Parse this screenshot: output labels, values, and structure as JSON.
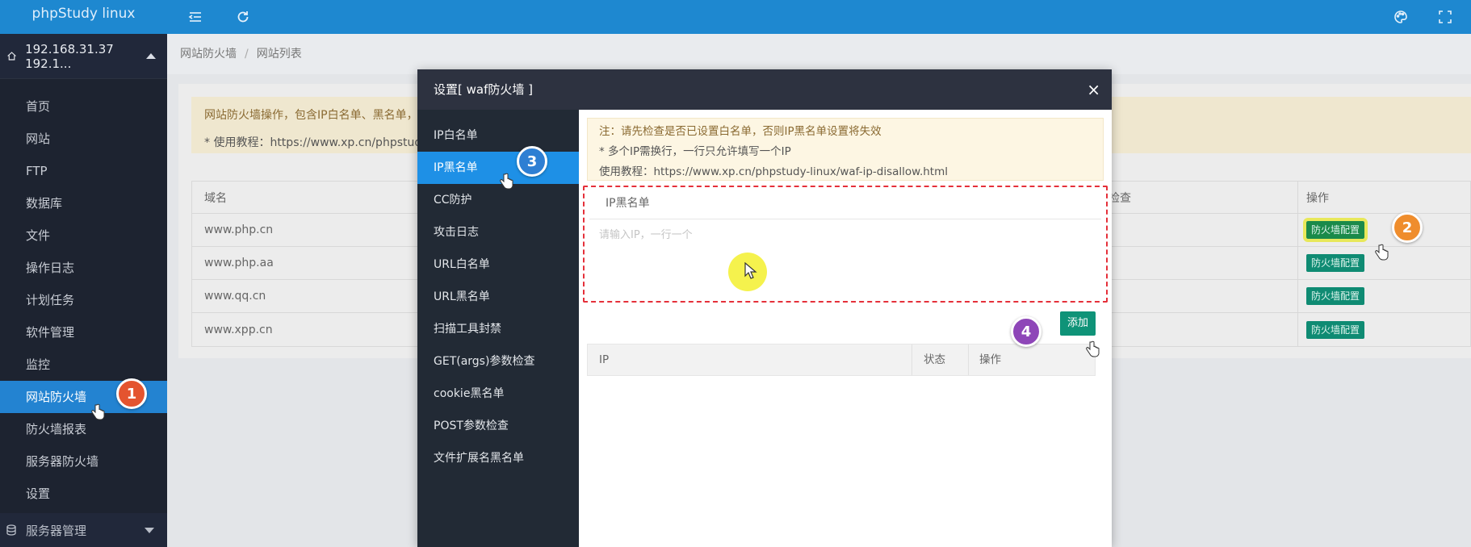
{
  "app": {
    "title": "phpStudy linux"
  },
  "sidebar": {
    "host": "192.168.31.37 192.1...",
    "items": [
      {
        "label": "首页"
      },
      {
        "label": "网站"
      },
      {
        "label": "FTP"
      },
      {
        "label": "数据库"
      },
      {
        "label": "文件"
      },
      {
        "label": "操作日志"
      },
      {
        "label": "计划任务"
      },
      {
        "label": "软件管理"
      },
      {
        "label": "监控"
      },
      {
        "label": "网站防火墙",
        "active": true
      },
      {
        "label": "防火墙报表"
      },
      {
        "label": "服务器防火墙"
      },
      {
        "label": "设置"
      }
    ],
    "server_mgmt": "服务器管理"
  },
  "breadcrumb": {
    "root": "网站防火墙",
    "sep": "/",
    "current": "网站列表"
  },
  "notice": {
    "line1": "网站防火墙操作，包含IP白名单、黑名单，",
    "line2": "* 使用教程：https://www.xp.cn/phpstudy-li"
  },
  "site_table": {
    "headers": {
      "domain": "域名",
      "check": "检查",
      "op": "操作"
    },
    "rows": [
      {
        "domain": "www.php.cn",
        "action": "防火墙配置"
      },
      {
        "domain": "www.php.aa",
        "action": "防火墙配置"
      },
      {
        "domain": "www.qq.cn",
        "action": "防火墙配置"
      },
      {
        "domain": "www.xpp.cn",
        "action": "防火墙配置"
      }
    ]
  },
  "modal": {
    "title": "设置[ waf防火墙 ]",
    "close": "×",
    "nav": [
      {
        "label": "IP白名单"
      },
      {
        "label": "IP黑名单",
        "active": true
      },
      {
        "label": "CC防护"
      },
      {
        "label": "攻击日志"
      },
      {
        "label": "URL白名单"
      },
      {
        "label": "URL黑名单"
      },
      {
        "label": "扫描工具封禁"
      },
      {
        "label": "GET(args)参数检查"
      },
      {
        "label": "cookie黑名单"
      },
      {
        "label": "POST参数检查"
      },
      {
        "label": "文件扩展名黑名单"
      }
    ],
    "hint": {
      "line1": "注：请先检查是否已设置白名单，否则IP黑名单设置将失效",
      "line2": "* 多个IP需换行，一行只允许填写一个IP",
      "line3": "使用教程：https://www.xp.cn/phpstudy-linux/waf-ip-disallow.html"
    },
    "blacklist": {
      "title": "IP黑名单",
      "placeholder": "请输入IP，一行一个",
      "value": ""
    },
    "add_label": "添加",
    "ip_table": {
      "ip": "IP",
      "status": "状态",
      "op": "操作"
    }
  },
  "annotations": {
    "b1": "1",
    "b2": "2",
    "b3": "3",
    "b4": "4"
  },
  "colors": {
    "accent": "#1e88d0",
    "sidebar_bg": "#1d2330",
    "green": "#0f9378",
    "danger": "#e5303a"
  }
}
